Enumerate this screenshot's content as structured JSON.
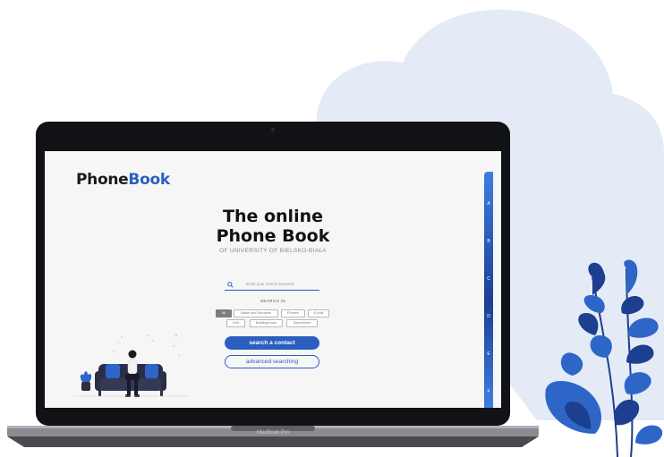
{
  "device": {
    "model_label": "MacBook Pro"
  },
  "phonebook": {
    "logo_part1": "Ph",
    "logo_o": "o",
    "logo_part2": "ne",
    "logo_part3": "Bo",
    "logo_part4": "ok",
    "title_line1": "The online",
    "title_line2": "Phone Book",
    "subtitle": "OF UNIVERSITY OF BIELSKO-BIAŁA",
    "search_placeholder": "Enter your search keyword",
    "search_in_label": "SEARCH IN",
    "filters": [
      {
        "label": "All",
        "active": true
      },
      {
        "label": "Name and Surname",
        "active": false
      },
      {
        "label": "Phones",
        "active": false
      },
      {
        "label": "E-mail",
        "active": false
      },
      {
        "label": "Unit",
        "active": false
      },
      {
        "label": "Building/room",
        "active": false
      },
      {
        "label": "Department",
        "active": false
      }
    ],
    "search_button": "search a contact",
    "advanced_button": "advanced searching",
    "alphabet": [
      "A",
      "B",
      "C",
      "D",
      "E",
      "F"
    ]
  },
  "colors": {
    "accent": "#2a5fbf",
    "blob": "#e4ebf7",
    "plant_dark": "#1c3f8f",
    "plant_light": "#2e66c8"
  }
}
